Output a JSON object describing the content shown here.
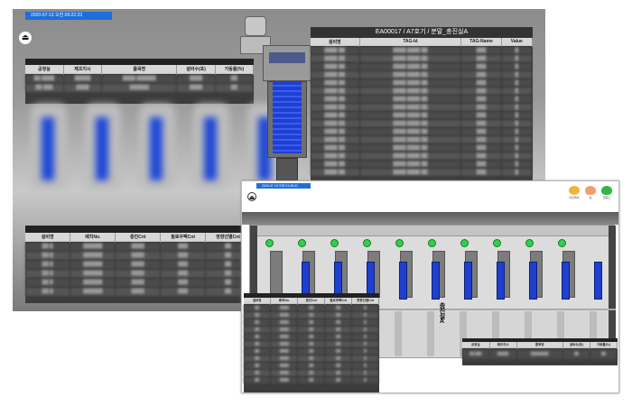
{
  "back_screen": {
    "datetime": "2020-07-13 오전 09:22:23",
    "info_table": {
      "headers": [
        "공정실",
        "제조지시",
        "품목명",
        "설비수(포)",
        "가동률(%)"
      ],
      "rows": [
        [
          "",
          "",
          "",
          "",
          ""
        ],
        [
          "",
          "",
          "",
          "",
          ""
        ]
      ]
    },
    "tag_panel": {
      "title": "EA00017 / A7호기 / 분말_충진실A",
      "headers": [
        "설비명",
        "TAG-Id",
        "TAG-Name",
        "Value"
      ],
      "row_count": 18
    },
    "count_table": {
      "headers": [
        "설비명",
        "배치No.",
        "충진Cnt",
        "필로우팩Cnt",
        "영향선별Cnt"
      ],
      "row_count": 6
    }
  },
  "front_screen": {
    "datetime": "2020-07-13 오후 01:28:41",
    "room_label": "충진실A",
    "top_icons": [
      {
        "name": "refresh-icon",
        "label": "리프레쉬",
        "color": "#f0b43c"
      },
      {
        "name": "home-icon",
        "label": "홈",
        "color": "#f0a06c"
      },
      {
        "name": "cloud-icon",
        "label": "업로드",
        "color": "#2fb845"
      }
    ],
    "count_table": {
      "headers": [
        "설비명",
        "배치No.",
        "충진Cnt",
        "필로우팩Cnt",
        "영향선별Cnt"
      ],
      "row_count": 11
    },
    "info_table": {
      "headers": [
        "공정실",
        "제조지시",
        "품목명",
        "설비수(포)",
        "가동률(%)"
      ],
      "row_count": 1
    },
    "machines": 10
  }
}
